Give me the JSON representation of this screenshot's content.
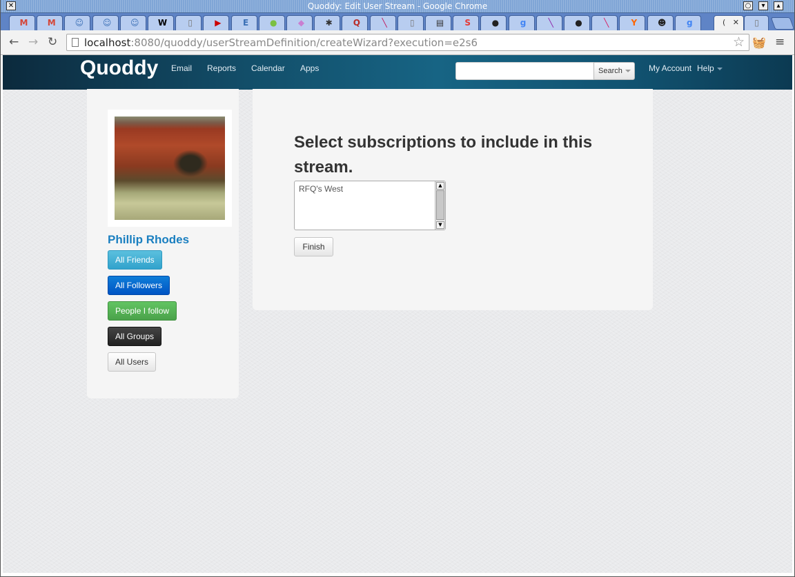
{
  "window": {
    "title": "Quoddy: Edit User Stream - Google Chrome"
  },
  "tabs": [
    {
      "icon": "gmail-icon",
      "glyph": "M",
      "color": "#d44638"
    },
    {
      "icon": "gmail-icon",
      "glyph": "M",
      "color": "#d44638"
    },
    {
      "icon": "jenkins-icon",
      "glyph": "☺",
      "color": "#3a6fb5"
    },
    {
      "icon": "jenkins-icon",
      "glyph": "☺",
      "color": "#3a6fb5"
    },
    {
      "icon": "jenkins-icon",
      "glyph": "☺",
      "color": "#3a6fb5"
    },
    {
      "icon": "wikipedia-icon",
      "glyph": "W",
      "color": "#000000"
    },
    {
      "icon": "blank-page-icon",
      "glyph": "▯",
      "color": "#777777"
    },
    {
      "icon": "youtube-icon",
      "glyph": "▶",
      "color": "#cc0000"
    },
    {
      "icon": "e-icon",
      "glyph": "E",
      "color": "#3a6fb5"
    },
    {
      "icon": "green-badge-icon",
      "glyph": "●",
      "color": "#7bc043"
    },
    {
      "icon": "tag-icon",
      "glyph": "◆",
      "color": "#c97fd1"
    },
    {
      "icon": "bug-icon",
      "glyph": "✱",
      "color": "#333333"
    },
    {
      "icon": "quora-icon",
      "glyph": "Q",
      "color": "#b92b27"
    },
    {
      "icon": "feather-icon",
      "glyph": "╲",
      "color": "#c2185b"
    },
    {
      "icon": "blank-page-icon",
      "glyph": "▯",
      "color": "#777777"
    },
    {
      "icon": "calendar-icon",
      "glyph": "▤",
      "color": "#333333"
    },
    {
      "icon": "s-icon",
      "glyph": "S",
      "color": "#e53935"
    },
    {
      "icon": "github-icon",
      "glyph": "●",
      "color": "#222222"
    },
    {
      "icon": "google-icon",
      "glyph": "g",
      "color": "#4285f4"
    },
    {
      "icon": "feather-icon",
      "glyph": "╲",
      "color": "#8e24aa"
    },
    {
      "icon": "github-icon",
      "glyph": "●",
      "color": "#222222"
    },
    {
      "icon": "feather-icon",
      "glyph": "╲",
      "color": "#d81b60"
    },
    {
      "icon": "ycombinator-icon",
      "glyph": "Y",
      "color": "#ff6600"
    },
    {
      "icon": "octocat-icon",
      "glyph": "☻",
      "color": "#222222"
    },
    {
      "icon": "google-icon",
      "glyph": "g",
      "color": "#4285f4"
    }
  ],
  "active_tab": {
    "label": "(",
    "close": "✕"
  },
  "address_bar": {
    "host": "localhost",
    "rest": ":8080/quoddy/userStreamDefinition/createWizard?execution=e2s6"
  },
  "site": {
    "brand": "Quoddy",
    "nav": [
      "Email",
      "Reports",
      "Calendar",
      "Apps"
    ],
    "search_button": "Search",
    "my_account": "My Account",
    "help": "Help"
  },
  "sidebar": {
    "user_name": "Phillip Rhodes",
    "buttons": [
      "All Friends",
      "All Followers",
      "People I follow",
      "All Groups",
      "All Users"
    ]
  },
  "main": {
    "heading": "Select subscriptions to include in this stream.",
    "options": [
      "RFQ's West"
    ],
    "finish": "Finish"
  }
}
